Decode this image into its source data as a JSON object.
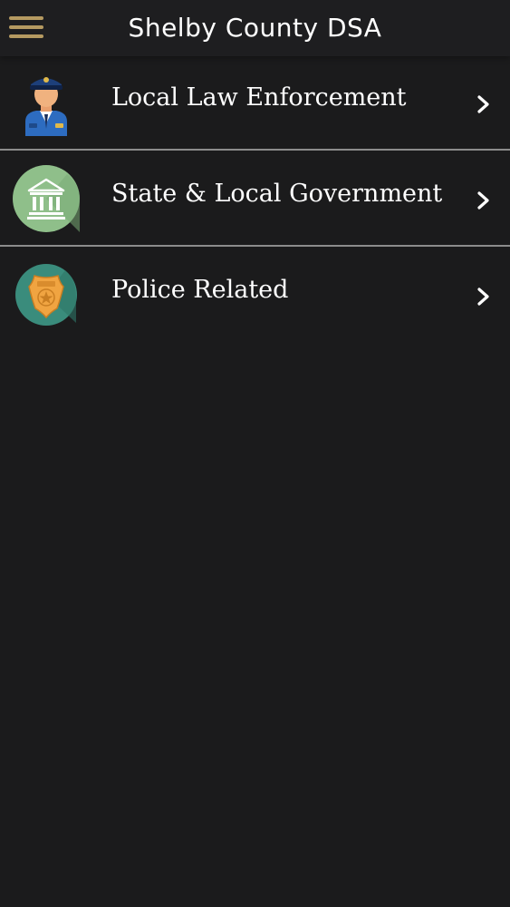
{
  "header": {
    "title": "Shelby County DSA",
    "menu_icon": "hamburger-menu-icon"
  },
  "colors": {
    "background": "#1b1b1c",
    "header_background": "#1e1e20",
    "accent": "#b59a61",
    "divider": "#8c8c8c",
    "text": "#ffffff"
  },
  "menu": {
    "items": [
      {
        "label": "Local Law Enforcement",
        "icon": "police-officer-icon"
      },
      {
        "label": "State & Local Government",
        "icon": "government-building-icon"
      },
      {
        "label": "Police Related",
        "icon": "police-badge-icon"
      }
    ],
    "chevron_icon": "chevron-right-icon"
  }
}
